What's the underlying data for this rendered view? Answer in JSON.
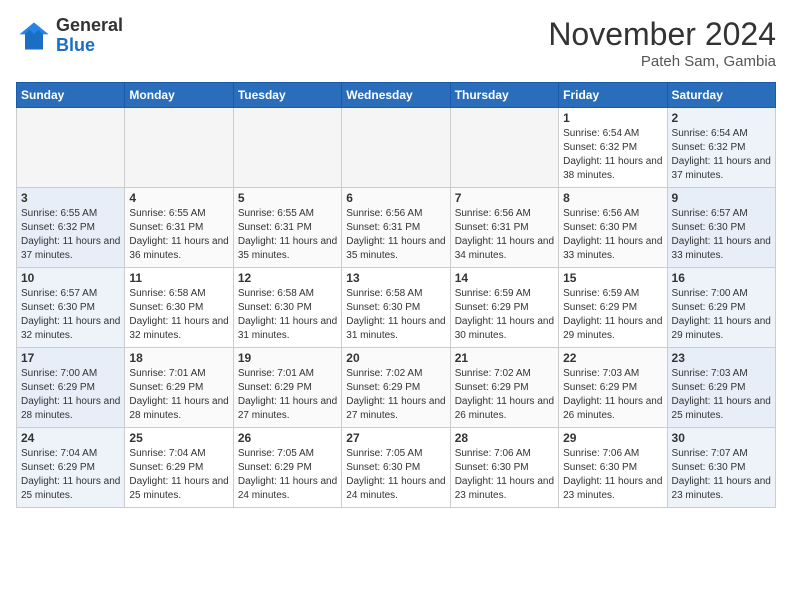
{
  "header": {
    "logo": {
      "general": "General",
      "blue": "Blue"
    },
    "title": "November 2024",
    "location": "Pateh Sam, Gambia"
  },
  "weekdays": [
    "Sunday",
    "Monday",
    "Tuesday",
    "Wednesday",
    "Thursday",
    "Friday",
    "Saturday"
  ],
  "weeks": [
    [
      {
        "day": "",
        "empty": true
      },
      {
        "day": "",
        "empty": true
      },
      {
        "day": "",
        "empty": true
      },
      {
        "day": "",
        "empty": true
      },
      {
        "day": "",
        "empty": true
      },
      {
        "day": "1",
        "sunrise": "6:54 AM",
        "sunset": "6:32 PM",
        "daylight": "11 hours and 38 minutes."
      },
      {
        "day": "2",
        "sunrise": "6:54 AM",
        "sunset": "6:32 PM",
        "daylight": "11 hours and 37 minutes.",
        "weekend": true
      }
    ],
    [
      {
        "day": "3",
        "sunrise": "6:55 AM",
        "sunset": "6:32 PM",
        "daylight": "11 hours and 37 minutes.",
        "weekend": true
      },
      {
        "day": "4",
        "sunrise": "6:55 AM",
        "sunset": "6:31 PM",
        "daylight": "11 hours and 36 minutes."
      },
      {
        "day": "5",
        "sunrise": "6:55 AM",
        "sunset": "6:31 PM",
        "daylight": "11 hours and 35 minutes."
      },
      {
        "day": "6",
        "sunrise": "6:56 AM",
        "sunset": "6:31 PM",
        "daylight": "11 hours and 35 minutes."
      },
      {
        "day": "7",
        "sunrise": "6:56 AM",
        "sunset": "6:31 PM",
        "daylight": "11 hours and 34 minutes."
      },
      {
        "day": "8",
        "sunrise": "6:56 AM",
        "sunset": "6:30 PM",
        "daylight": "11 hours and 33 minutes."
      },
      {
        "day": "9",
        "sunrise": "6:57 AM",
        "sunset": "6:30 PM",
        "daylight": "11 hours and 33 minutes.",
        "weekend": true
      }
    ],
    [
      {
        "day": "10",
        "sunrise": "6:57 AM",
        "sunset": "6:30 PM",
        "daylight": "11 hours and 32 minutes.",
        "weekend": true
      },
      {
        "day": "11",
        "sunrise": "6:58 AM",
        "sunset": "6:30 PM",
        "daylight": "11 hours and 32 minutes."
      },
      {
        "day": "12",
        "sunrise": "6:58 AM",
        "sunset": "6:30 PM",
        "daylight": "11 hours and 31 minutes."
      },
      {
        "day": "13",
        "sunrise": "6:58 AM",
        "sunset": "6:30 PM",
        "daylight": "11 hours and 31 minutes."
      },
      {
        "day": "14",
        "sunrise": "6:59 AM",
        "sunset": "6:29 PM",
        "daylight": "11 hours and 30 minutes."
      },
      {
        "day": "15",
        "sunrise": "6:59 AM",
        "sunset": "6:29 PM",
        "daylight": "11 hours and 29 minutes."
      },
      {
        "day": "16",
        "sunrise": "7:00 AM",
        "sunset": "6:29 PM",
        "daylight": "11 hours and 29 minutes.",
        "weekend": true
      }
    ],
    [
      {
        "day": "17",
        "sunrise": "7:00 AM",
        "sunset": "6:29 PM",
        "daylight": "11 hours and 28 minutes.",
        "weekend": true
      },
      {
        "day": "18",
        "sunrise": "7:01 AM",
        "sunset": "6:29 PM",
        "daylight": "11 hours and 28 minutes."
      },
      {
        "day": "19",
        "sunrise": "7:01 AM",
        "sunset": "6:29 PM",
        "daylight": "11 hours and 27 minutes."
      },
      {
        "day": "20",
        "sunrise": "7:02 AM",
        "sunset": "6:29 PM",
        "daylight": "11 hours and 27 minutes."
      },
      {
        "day": "21",
        "sunrise": "7:02 AM",
        "sunset": "6:29 PM",
        "daylight": "11 hours and 26 minutes."
      },
      {
        "day": "22",
        "sunrise": "7:03 AM",
        "sunset": "6:29 PM",
        "daylight": "11 hours and 26 minutes."
      },
      {
        "day": "23",
        "sunrise": "7:03 AM",
        "sunset": "6:29 PM",
        "daylight": "11 hours and 25 minutes.",
        "weekend": true
      }
    ],
    [
      {
        "day": "24",
        "sunrise": "7:04 AM",
        "sunset": "6:29 PM",
        "daylight": "11 hours and 25 minutes.",
        "weekend": true
      },
      {
        "day": "25",
        "sunrise": "7:04 AM",
        "sunset": "6:29 PM",
        "daylight": "11 hours and 25 minutes."
      },
      {
        "day": "26",
        "sunrise": "7:05 AM",
        "sunset": "6:29 PM",
        "daylight": "11 hours and 24 minutes."
      },
      {
        "day": "27",
        "sunrise": "7:05 AM",
        "sunset": "6:30 PM",
        "daylight": "11 hours and 24 minutes."
      },
      {
        "day": "28",
        "sunrise": "7:06 AM",
        "sunset": "6:30 PM",
        "daylight": "11 hours and 23 minutes."
      },
      {
        "day": "29",
        "sunrise": "7:06 AM",
        "sunset": "6:30 PM",
        "daylight": "11 hours and 23 minutes."
      },
      {
        "day": "30",
        "sunrise": "7:07 AM",
        "sunset": "6:30 PM",
        "daylight": "11 hours and 23 minutes.",
        "weekend": true
      }
    ]
  ]
}
